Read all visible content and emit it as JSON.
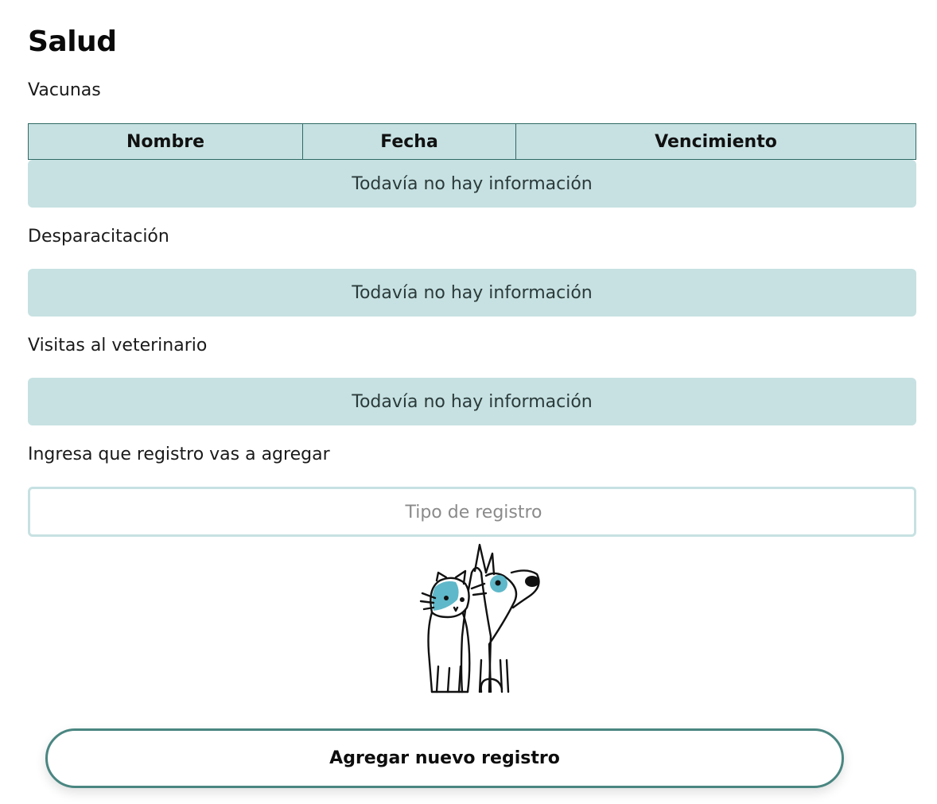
{
  "page": {
    "title": "Salud"
  },
  "vaccines": {
    "label": "Vacunas",
    "columns": [
      "Nombre",
      "Fecha",
      "Vencimiento"
    ],
    "empty_text": "Todavía no hay información"
  },
  "deworming": {
    "label": "Desparacitación",
    "empty_text": "Todavía no hay información"
  },
  "vet_visits": {
    "label": "Visitas al veterinario",
    "empty_text": "Todavía no hay información"
  },
  "record_form": {
    "label": "Ingresa que registro vas a agregar",
    "placeholder": "Tipo de registro",
    "value": ""
  },
  "actions": {
    "add_label": "Agregar nuevo registro"
  },
  "colors": {
    "panel_bg": "#c7e1e2",
    "table_border": "#2f6a64",
    "button_border": "#4a8681",
    "spot_accent": "#5fb8c9"
  },
  "illustration": {
    "icon": "cat-and-dog-illustration"
  }
}
